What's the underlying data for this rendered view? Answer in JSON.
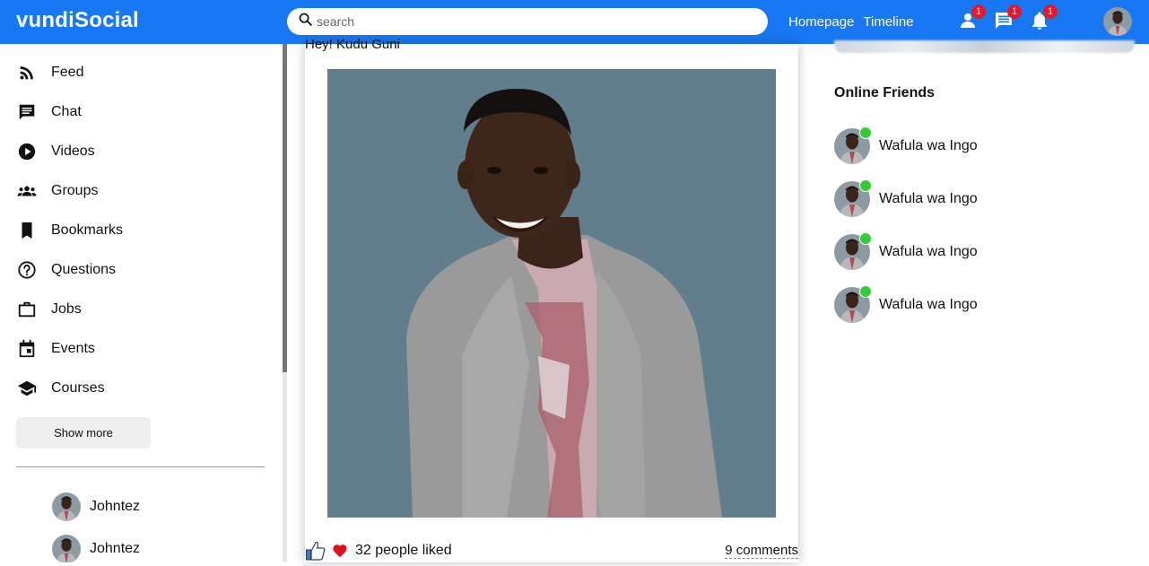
{
  "app": {
    "logo": "vundiSocial"
  },
  "search": {
    "placeholder": "search"
  },
  "topbar": {
    "links": [
      "Homepage",
      "Timeline"
    ],
    "badges": {
      "friends": "1",
      "messages": "1",
      "notifications": "1"
    }
  },
  "sidebar": {
    "items": [
      {
        "label": "Feed",
        "icon": "rss-feed-icon"
      },
      {
        "label": "Chat",
        "icon": "chat-icon"
      },
      {
        "label": "Videos",
        "icon": "play-circle-icon"
      },
      {
        "label": "Groups",
        "icon": "group-icon"
      },
      {
        "label": "Bookmarks",
        "icon": "bookmark-icon"
      },
      {
        "label": "Questions",
        "icon": "help-circle-icon"
      },
      {
        "label": "Jobs",
        "icon": "briefcase-icon"
      },
      {
        "label": "Events",
        "icon": "calendar-event-icon"
      },
      {
        "label": "Courses",
        "icon": "school-icon"
      }
    ],
    "show_more": "Show more",
    "friends": [
      "Johntez",
      "Johntez"
    ]
  },
  "post": {
    "text": "Hey! Kudu Guni",
    "likes": "32 people liked",
    "comments": "9 comments"
  },
  "rightbar": {
    "title": "Online Friends",
    "friends": [
      "Wafula wa Ingo",
      "Wafula wa Ingo",
      "Wafula wa Ingo",
      "Wafula wa Ingo"
    ]
  },
  "colors": {
    "brand": "#1877f2",
    "badge": "#e0192c",
    "online": "#32cd32",
    "photo_bg": "#627d8b"
  }
}
